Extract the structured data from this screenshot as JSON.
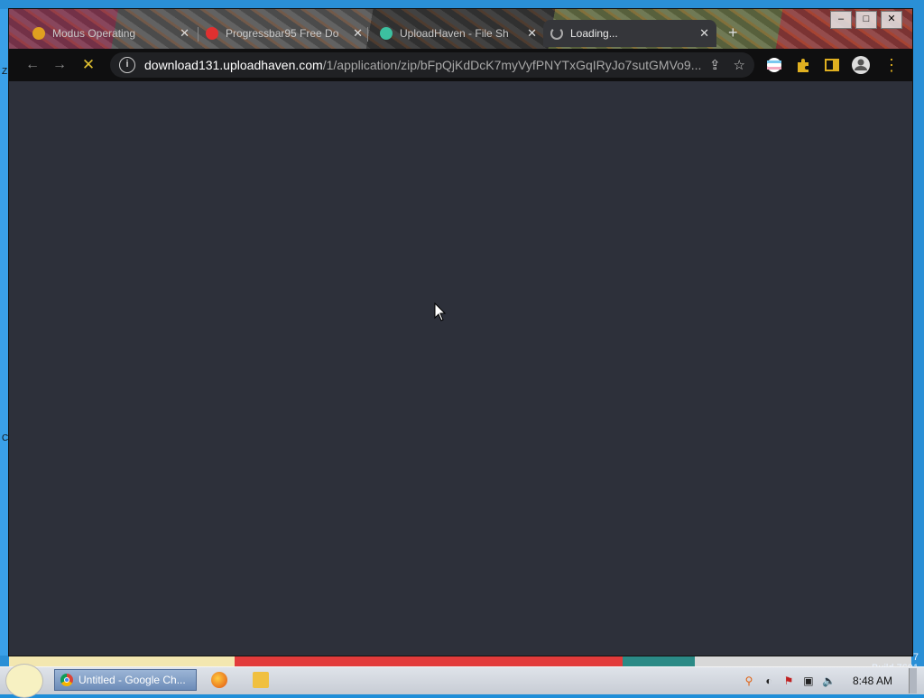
{
  "desktop": {
    "left_edge_letters": [
      "Z",
      "C"
    ],
    "build_number_fragment": "7",
    "build_label": "Build 7601"
  },
  "browser": {
    "tabs": [
      {
        "title": "Modus Operating",
        "favicon_color": "#e0a020",
        "active": false
      },
      {
        "title": "Progressbar95 Free Do",
        "favicon_color": "#e03030",
        "active": false
      },
      {
        "title": "UploadHaven - File Sh",
        "favicon_color": "#3cc0a0",
        "active": false
      },
      {
        "title": "Loading...",
        "favicon_color": "#aaaaaa",
        "active": true
      }
    ],
    "new_tab_symbol": "+",
    "window_controls": {
      "minimize": "–",
      "maximize": "□",
      "close": "✕"
    },
    "nav": {
      "back": "←",
      "forward": "→",
      "stop": "✕"
    },
    "url": {
      "host": "download131.uploadhaven.com",
      "path": "/1/application/zip/bFpQjKdDcK7myVyfPNYTxGqIRyJo7sutGMVo9..."
    },
    "omnibox_icons": [
      "share-icon",
      "bookmark-star-icon"
    ],
    "toolbar_icons": [
      "translate-flag-icon",
      "extensions-puzzle-icon",
      "side-panel-icon",
      "profile-icon",
      "menu-kebab-icon"
    ],
    "content_bg": "#2d303a"
  },
  "taskbar": {
    "task_button_label": "Untitled - Google Ch...",
    "clock": "8:48 AM",
    "tray_icons": [
      "search-magnifier-icon",
      "language-icon",
      "flag-warning-icon",
      "network-icon",
      "volume-icon"
    ]
  }
}
